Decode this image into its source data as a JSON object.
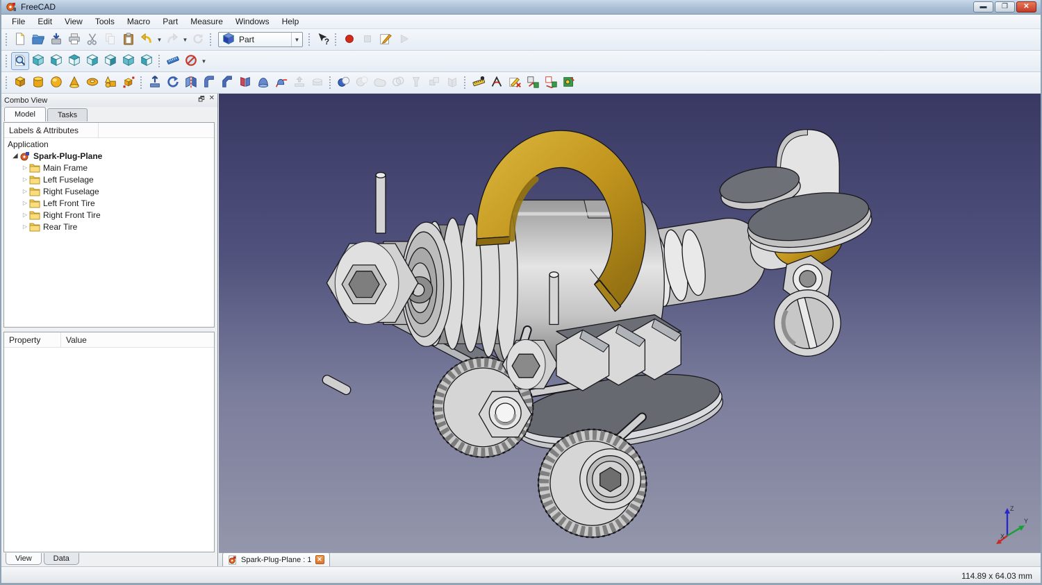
{
  "window": {
    "title": "FreeCAD",
    "minimize": "minimize",
    "restore": "restore",
    "close": "close"
  },
  "menu_bar": {
    "items": [
      "File",
      "Edit",
      "View",
      "Tools",
      "Macro",
      "Part",
      "Measure",
      "Windows",
      "Help"
    ]
  },
  "workbench_selector": {
    "value": "Part"
  },
  "toolbar_rows": [
    {
      "groups": [
        {
          "name": "file",
          "items": [
            {
              "icon": "new-document"
            },
            {
              "icon": "open-folder"
            },
            {
              "icon": "save"
            },
            {
              "icon": "print"
            },
            {
              "icon": "cut"
            },
            {
              "icon": "copy",
              "enabled": false
            },
            {
              "icon": "paste"
            },
            {
              "icon": "undo",
              "caret": true
            },
            {
              "icon": "redo",
              "enabled": false,
              "caret": true
            },
            {
              "icon": "refresh",
              "enabled": false
            }
          ]
        },
        {
          "name": "workbench",
          "type": "combo"
        },
        {
          "name": "help",
          "items": [
            {
              "icon": "whats-this"
            }
          ]
        },
        {
          "name": "macro",
          "items": [
            {
              "icon": "macro-record"
            },
            {
              "icon": "macro-stop",
              "enabled": false
            },
            {
              "icon": "macro-edit"
            },
            {
              "icon": "macro-play",
              "enabled": false
            }
          ]
        }
      ]
    },
    {
      "groups": [
        {
          "name": "view",
          "items": [
            {
              "icon": "fit-all",
              "pressed": true
            },
            {
              "icon": "view-axonometric"
            },
            {
              "icon": "view-front"
            },
            {
              "icon": "view-top"
            },
            {
              "icon": "view-right"
            },
            {
              "icon": "view-rear"
            },
            {
              "icon": "view-bottom"
            },
            {
              "icon": "view-left"
            }
          ]
        },
        {
          "name": "clip",
          "items": [
            {
              "icon": "measure-distance"
            },
            {
              "icon": "clear-clipping",
              "caret": true
            }
          ]
        }
      ]
    },
    {
      "groups": [
        {
          "name": "primitives",
          "items": [
            {
              "icon": "part-box"
            },
            {
              "icon": "part-cylinder"
            },
            {
              "icon": "part-sphere"
            },
            {
              "icon": "part-cone"
            },
            {
              "icon": "part-torus"
            },
            {
              "icon": "part-primitives"
            },
            {
              "icon": "shape-builder"
            }
          ]
        },
        {
          "name": "part-tools",
          "items": [
            {
              "icon": "extrude"
            },
            {
              "icon": "revolve"
            },
            {
              "icon": "mirror"
            },
            {
              "icon": "fillet"
            },
            {
              "icon": "chamfer"
            },
            {
              "icon": "ruled-surface"
            },
            {
              "icon": "loft"
            },
            {
              "icon": "sweep"
            },
            {
              "icon": "offset",
              "enabled": false
            },
            {
              "icon": "thickness",
              "enabled": false
            }
          ]
        },
        {
          "name": "boolean",
          "items": [
            {
              "icon": "boolean"
            },
            {
              "icon": "boolean-cut",
              "enabled": false
            },
            {
              "icon": "boolean-union",
              "enabled": false
            },
            {
              "icon": "boolean-common",
              "enabled": false
            },
            {
              "icon": "boolean-join",
              "enabled": false
            },
            {
              "icon": "compound",
              "enabled": false
            },
            {
              "icon": "splitter",
              "enabled": false
            }
          ]
        },
        {
          "name": "measure",
          "items": [
            {
              "icon": "measure-linear"
            },
            {
              "icon": "measure-angular"
            },
            {
              "icon": "measure-clear-all"
            },
            {
              "icon": "measure-toggle-all"
            },
            {
              "icon": "measure-toggle-3d"
            },
            {
              "icon": "measure-toggle-delta"
            }
          ]
        }
      ]
    }
  ],
  "combo_view": {
    "title": "Combo View",
    "tabs": [
      {
        "label": "Model",
        "active": true
      },
      {
        "label": "Tasks",
        "active": false
      }
    ],
    "tree_header": "Labels & Attributes",
    "application_label": "Application",
    "document": {
      "label": "Spark-Plug-Plane"
    },
    "items": [
      "Main Frame",
      "Left Fuselage",
      "Right Fuselage",
      "Left Front Tire",
      "Right Front Tire",
      "Rear Tire"
    ],
    "property_columns": [
      "Property",
      "Value"
    ],
    "bottom_tabs": [
      {
        "label": "View",
        "active": true
      },
      {
        "label": "Data",
        "active": false
      }
    ]
  },
  "viewport": {
    "document_tab": {
      "label": "Spark-Plug-Plane : 1"
    },
    "axis_labels": {
      "x": "X",
      "y": "Y",
      "z": "Z"
    },
    "colors": {
      "background_top": "#3a3a66",
      "background_bottom": "#9496ab",
      "model_gold": "#c79a20",
      "model_metal": "#c9c9c9",
      "model_dark_plate": "#66696f"
    }
  },
  "status_bar": {
    "dimensions": "114.89 x 64.03 mm"
  }
}
